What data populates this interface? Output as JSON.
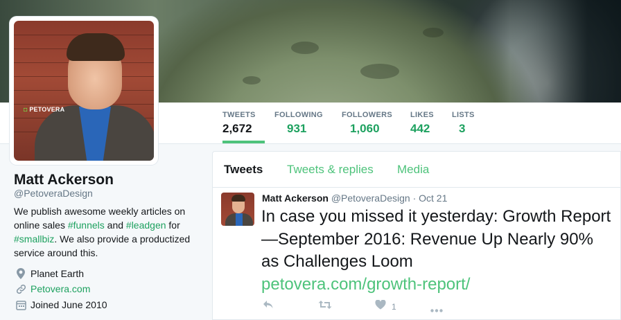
{
  "profile": {
    "name": "Matt Ackerson",
    "handle": "@PetoveraDesign",
    "avatar_logo": "PETOVERA",
    "bio": {
      "part1": "We publish awesome weekly articles on online sales ",
      "tag1": "#funnels",
      "part2": " and ",
      "tag2": "#leadgen",
      "part3": " for ",
      "tag3": "#smallbiz",
      "part4": ". We also provide a productized service around this."
    },
    "location": "Planet Earth",
    "website": "Petovera.com",
    "joined": "Joined June 2010"
  },
  "stats": [
    {
      "label": "TWEETS",
      "value": "2,672"
    },
    {
      "label": "FOLLOWING",
      "value": "931"
    },
    {
      "label": "FOLLOWERS",
      "value": "1,060"
    },
    {
      "label": "LIKES",
      "value": "442"
    },
    {
      "label": "LISTS",
      "value": "3"
    }
  ],
  "tabs": {
    "tweets": "Tweets",
    "replies": "Tweets & replies",
    "media": "Media"
  },
  "tweet": {
    "author": "Matt Ackerson",
    "handle": "@PetoveraDesign",
    "separator": "·",
    "date": "Oct 21",
    "text": "In case you missed it yesterday: Growth Report—September 2016: Revenue Up Nearly 90% as Challenges Loom",
    "link": "petovera.com/growth-report/",
    "likes": "1"
  },
  "colors": {
    "accent": "#4ec37b",
    "link": "#1da15f",
    "muted": "#657786",
    "background": "#f5f8fa"
  },
  "icons": {
    "location": "map-pin-icon",
    "website": "link-icon",
    "joined": "calendar-icon",
    "reply": "reply-icon",
    "retweet": "retweet-icon",
    "like": "heart-icon",
    "more": "more-dots-icon"
  }
}
